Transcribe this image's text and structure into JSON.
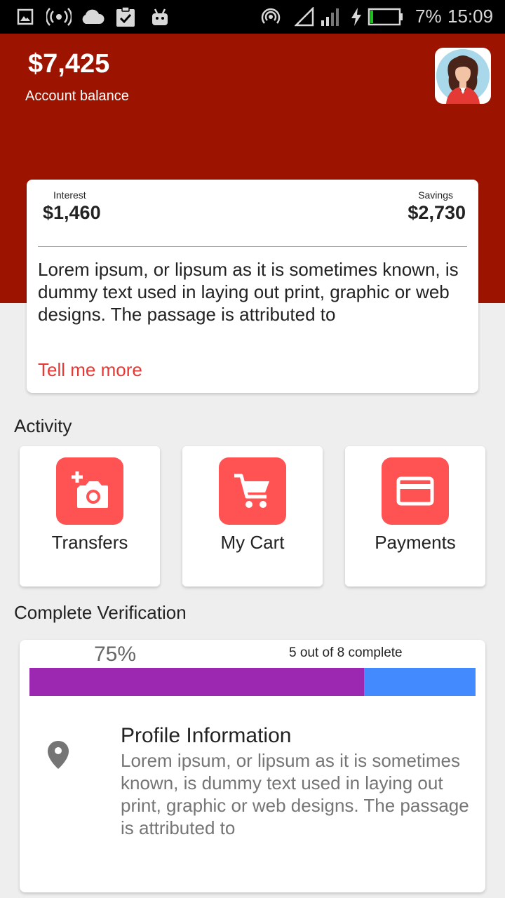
{
  "status_bar": {
    "battery_percent": "7%",
    "time": "15:09",
    "icons": [
      "image-icon",
      "broadcast-icon",
      "cloud-icon",
      "clipboard-check-icon",
      "android-icon",
      "hotspot-icon",
      "signal-icon",
      "signal-bars-icon",
      "charging-icon",
      "battery-icon"
    ]
  },
  "header": {
    "balance": "$7,425",
    "balance_label": "Account balance",
    "background_color": "#9c1400"
  },
  "summary": {
    "interest_label": "Interest",
    "interest_value": "$1,460",
    "savings_label": "Savings",
    "savings_value": "$2,730",
    "description": "Lorem ipsum, or lipsum as it is sometimes known, is dummy text used in laying out print, graphic or web designs. The passage is attributed to",
    "link": "Tell me more"
  },
  "activity": {
    "title": "Activity",
    "tiles": [
      {
        "label": "Transfers",
        "icon": "add-photo-icon"
      },
      {
        "label": "My Cart",
        "icon": "cart-icon"
      },
      {
        "label": "Payments",
        "icon": "credit-card-icon"
      }
    ],
    "accent_color": "#ff5252"
  },
  "verification": {
    "title": "Complete Verification",
    "percent_label": "75%",
    "progress": 0.75,
    "progress_text": "5 out of 8 complete",
    "fill_color": "#9c27b0",
    "track_color": "#448aff",
    "item": {
      "icon": "location-pin-icon",
      "title": "Profile Information",
      "text": "Lorem ipsum, or lipsum as it is sometimes known, is dummy text used in laying out print, graphic or web designs. The passage is attributed to"
    }
  }
}
